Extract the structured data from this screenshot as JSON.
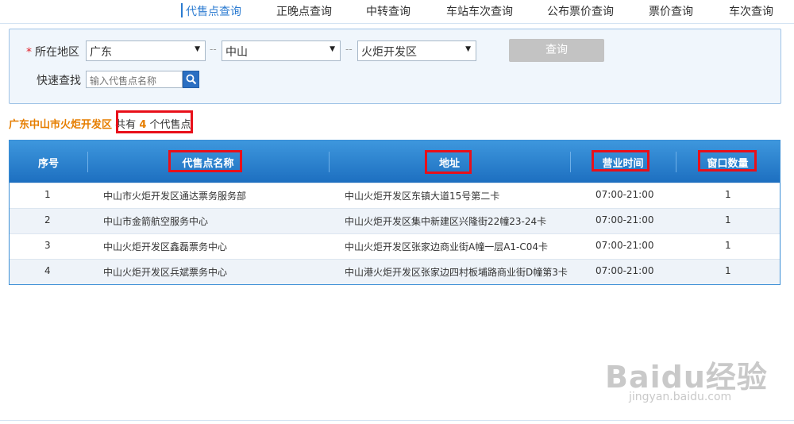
{
  "nav": {
    "items": [
      {
        "label": "代售点查询",
        "active": true
      },
      {
        "label": "正晚点查询"
      },
      {
        "label": "中转查询"
      },
      {
        "label": "车站车次查询"
      },
      {
        "label": "公布票价查询"
      },
      {
        "label": "票价查询"
      },
      {
        "label": "车次查询"
      }
    ]
  },
  "search": {
    "region_label": "所在地区",
    "required_mark": "*",
    "province": "广东",
    "city": "中山",
    "district": "火炬开发区",
    "separator": "--",
    "query_button": "查询",
    "quick_label": "快速查找",
    "quick_placeholder": "输入代售点名称"
  },
  "summary": {
    "region": "广东中山市火炬开发区",
    "prefix": "共有",
    "count": "4",
    "suffix": "个代售点"
  },
  "table": {
    "columns": [
      "序号",
      "代售点名称",
      "地址",
      "营业时间",
      "窗口数量"
    ],
    "rows": [
      {
        "no": "1",
        "name": "中山市火炬开发区通达票务服务部",
        "address": "中山火炬开发区东镇大道15号第二卡",
        "hours": "07:00-21:00",
        "windows": "1"
      },
      {
        "no": "2",
        "name": "中山市金箭航空服务中心",
        "address": "中山火炬开发区集中新建区兴隆街22幢23-24卡",
        "hours": "07:00-21:00",
        "windows": "1"
      },
      {
        "no": "3",
        "name": "中山火炬开发区鑫磊票务中心",
        "address": "中山火炬开发区张家边商业街A幢一层A1-C04卡",
        "hours": "07:00-21:00",
        "windows": "1"
      },
      {
        "no": "4",
        "name": "中山火炬开发区兵斌票务中心",
        "address": "中山港火炬开发区张家边四村板埔路商业街D幢第3卡",
        "hours": "07:00-21:00",
        "windows": "1"
      }
    ]
  },
  "watermark": {
    "brand": "Baidu经验",
    "url": "jingyan.baidu.com"
  },
  "colors": {
    "accent": "#2b7bd1",
    "highlight": "#e8101a",
    "orange": "#e67e00",
    "header": "#1d6fc0"
  }
}
